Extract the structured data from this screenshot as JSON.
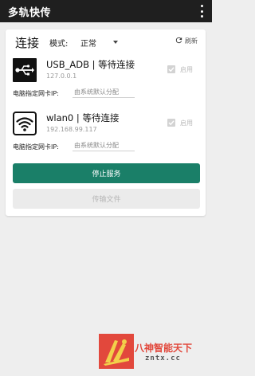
{
  "app_bar": {
    "title": "多轨快传",
    "menu_icon": "more-vert-icon"
  },
  "card": {
    "heading": "连接",
    "mode_label": "模式:",
    "mode_value": "正常",
    "refresh_label": "刷新",
    "refresh_icon": "refresh-icon",
    "connections": [
      {
        "icon": "usb-icon",
        "name": "USB_ADB | 等待连接",
        "ip": "127.0.0.1",
        "enable_label": "启用",
        "enabled": true,
        "nic_label": "电脑指定网卡IP:",
        "nic_placeholder": "由系统默认分配"
      },
      {
        "icon": "wifi-icon",
        "name": "wlan0 | 等待连接",
        "ip": "192.168.99.117",
        "enable_label": "启用",
        "enabled": true,
        "nic_label": "电脑指定网卡IP:",
        "nic_placeholder": "由系统默认分配"
      }
    ],
    "stop_button": "停止服务",
    "transfer_button": "传输文件"
  },
  "watermark": {
    "title": "八神智能天下",
    "subtitle": "zntx.cc"
  },
  "colors": {
    "app_bar": "#1f1f1f",
    "primary_button": "#1a7f68",
    "watermark_red": "#e2483c",
    "watermark_yellow": "#f2d04a"
  }
}
